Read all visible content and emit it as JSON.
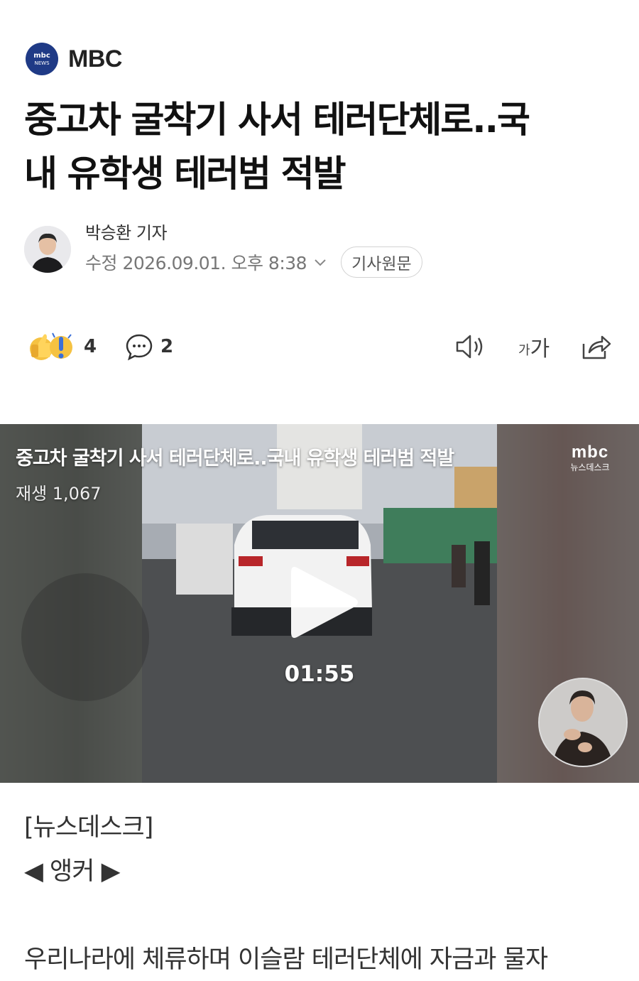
{
  "press": {
    "logo_line1": "mbc",
    "logo_line2": "NEWS",
    "name": "MBC"
  },
  "article": {
    "title_line1": "중고차 굴착기 사서 테러단체로..국",
    "title_line2": "내 유학생 테러범 적발",
    "author": "박승환 기자",
    "date": "수정 2026.09.01. 오후 8:38",
    "original_label": "기사원문"
  },
  "actions": {
    "reaction_count": "4",
    "comment_count": "2",
    "font_size_label_small": "가",
    "font_size_label_large": "가"
  },
  "video": {
    "title": "중고차 굴착기 사서 테러단체로..국내 유학생 테러범 적발",
    "plays": "재생 1,067",
    "brand_line1": "mbc",
    "brand_line2": "뉴스데스크",
    "duration": "01:55"
  },
  "body": {
    "line1": "[뉴스데스크]",
    "line2": "◀ 앵커 ▶",
    "line3": "우리나라에 체류하며 이슬람 테러단체에 자금과 물자"
  },
  "colors": {
    "logo_bg": "#1f3a86",
    "text": "#111111",
    "meta": "#777777",
    "accent_yellow": "#f5c242"
  }
}
